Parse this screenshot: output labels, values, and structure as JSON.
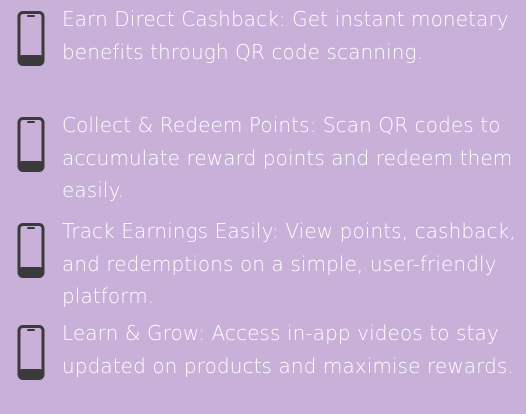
{
  "features": [
    {
      "icon": "phone-icon",
      "text": "Earn Direct Cashback: Get instant monetary benefits through QR code scanning."
    },
    {
      "icon": "phone-icon",
      "text": "Collect & Redeem Points: Scan QR codes to accumulate reward points and redeem them easily."
    },
    {
      "icon": "phone-icon",
      "text": "Track Earnings Easily: View points, cashback, and redemptions on a simple, user-friendly platform."
    },
    {
      "icon": "phone-icon",
      "text": "Learn & Grow: Access in-app videos to stay updated on products and maximise rewards."
    }
  ],
  "colors": {
    "background": "#c9b0d9",
    "text": "#ffffff",
    "icon": "#3a3a3a"
  }
}
